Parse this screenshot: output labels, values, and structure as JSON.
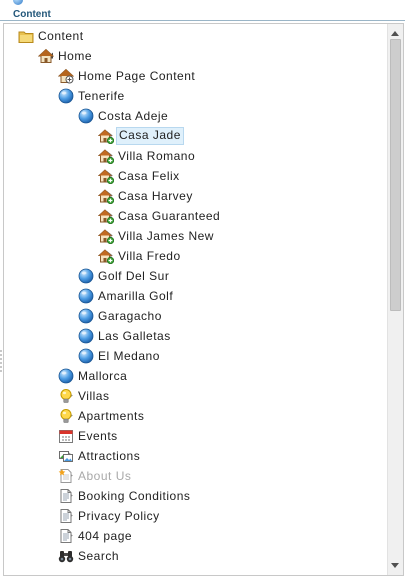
{
  "pane": {
    "title": "Content"
  },
  "tree": {
    "nodes": [
      {
        "label": "Content",
        "icon": "folder-icon",
        "depth": 0,
        "expander": "none",
        "state": "normal"
      },
      {
        "label": "Home",
        "icon": "home-icon",
        "depth": 1,
        "expander": "expanded",
        "state": "normal"
      },
      {
        "label": "Home Page Content",
        "icon": "home-content-icon",
        "depth": 2,
        "expander": "collapsed",
        "state": "normal"
      },
      {
        "label": "Tenerife",
        "icon": "globe-icon",
        "depth": 2,
        "expander": "expanded",
        "state": "normal"
      },
      {
        "label": "Costa Adeje",
        "icon": "globe-icon",
        "depth": 3,
        "expander": "expanded",
        "state": "normal"
      },
      {
        "label": "Casa Jade",
        "icon": "house-icon",
        "depth": 4,
        "expander": "collapsed",
        "state": "selected"
      },
      {
        "label": "Villa Romano",
        "icon": "house-icon",
        "depth": 4,
        "expander": "collapsed",
        "state": "normal"
      },
      {
        "label": "Casa Felix",
        "icon": "house-icon",
        "depth": 4,
        "expander": "collapsed",
        "state": "normal"
      },
      {
        "label": "Casa Harvey",
        "icon": "house-icon",
        "depth": 4,
        "expander": "collapsed",
        "state": "normal"
      },
      {
        "label": "Casa Guaranteed",
        "icon": "house-icon",
        "depth": 4,
        "expander": "collapsed",
        "state": "normal"
      },
      {
        "label": "Villa James New",
        "icon": "house-icon",
        "depth": 4,
        "expander": "collapsed",
        "state": "normal"
      },
      {
        "label": "Villa Fredo",
        "icon": "house-icon",
        "depth": 4,
        "expander": "collapsed",
        "state": "normal"
      },
      {
        "label": "Golf Del Sur",
        "icon": "globe-icon",
        "depth": 3,
        "expander": "collapsed",
        "state": "normal"
      },
      {
        "label": "Amarilla Golf",
        "icon": "globe-icon",
        "depth": 3,
        "expander": "collapsed",
        "state": "normal"
      },
      {
        "label": "Garagacho",
        "icon": "globe-icon",
        "depth": 3,
        "expander": "collapsed",
        "state": "normal"
      },
      {
        "label": "Las Galletas",
        "icon": "globe-icon",
        "depth": 3,
        "expander": "collapsed",
        "state": "normal"
      },
      {
        "label": "El Medano",
        "icon": "globe-icon",
        "depth": 3,
        "expander": "collapsed",
        "state": "normal"
      },
      {
        "label": "Mallorca",
        "icon": "globe-icon",
        "depth": 2,
        "expander": "collapsed",
        "state": "normal"
      },
      {
        "label": "Villas",
        "icon": "lightbulb-icon",
        "depth": 2,
        "expander": "collapsed",
        "state": "normal"
      },
      {
        "label": "Apartments",
        "icon": "lightbulb-icon",
        "depth": 2,
        "expander": "collapsed",
        "state": "normal"
      },
      {
        "label": "Events",
        "icon": "calendar-icon",
        "depth": 2,
        "expander": "collapsed",
        "state": "normal"
      },
      {
        "label": "Attractions",
        "icon": "image-gallery-icon",
        "depth": 2,
        "expander": "collapsed",
        "state": "normal"
      },
      {
        "label": "About Us",
        "icon": "new-document-icon",
        "depth": 2,
        "expander": "collapsed",
        "state": "disabled"
      },
      {
        "label": "Booking Conditions",
        "icon": "document-icon",
        "depth": 2,
        "expander": "collapsed",
        "state": "normal"
      },
      {
        "label": "Privacy Policy",
        "icon": "document-icon",
        "depth": 2,
        "expander": "collapsed",
        "state": "normal"
      },
      {
        "label": "404 page",
        "icon": "document-icon",
        "depth": 2,
        "expander": "collapsed",
        "state": "normal"
      },
      {
        "label": "Search",
        "icon": "binoculars-icon",
        "depth": 2,
        "expander": "none",
        "state": "normal"
      }
    ]
  },
  "colors": {
    "header_text": "#23577a",
    "selected_bg": "#dff0fb",
    "disabled_text": "#a9a9a9",
    "house_roof": "#b5651d",
    "globe": "#2f79c8",
    "green_plus": "#3aa335"
  }
}
